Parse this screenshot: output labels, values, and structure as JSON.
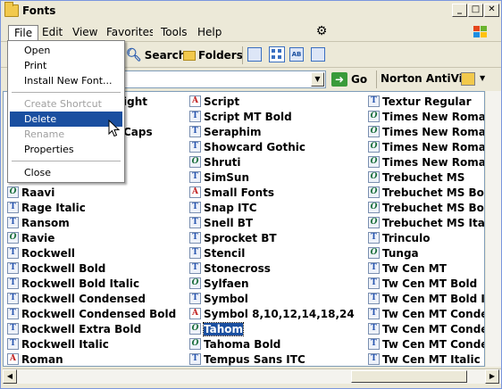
{
  "window": {
    "title": "Fonts"
  },
  "title_buttons": {
    "minimize": "_",
    "maximize": "□",
    "close": "✕"
  },
  "menubar": [
    "File",
    "Edit",
    "View",
    "Favorites",
    "Tools",
    "Help"
  ],
  "toolbar": {
    "search": "Search",
    "folders": "Folders"
  },
  "address": {
    "go": "Go",
    "norton": "Norton AntiVir"
  },
  "file_menu": {
    "items": [
      {
        "label": "Open",
        "state": "normal"
      },
      {
        "label": "Print",
        "state": "normal"
      },
      {
        "label": "Install New Font...",
        "state": "normal"
      },
      {
        "sep": true
      },
      {
        "label": "Create Shortcut",
        "state": "disabled"
      },
      {
        "label": "Delete",
        "state": "highlighted"
      },
      {
        "label": "Rename",
        "state": "disabled"
      },
      {
        "label": "Properties",
        "state": "normal"
      },
      {
        "sep": true
      },
      {
        "label": "Close",
        "state": "normal"
      }
    ]
  },
  "fonts": {
    "col1_partial": [
      "ight",
      "",
      "Caps"
    ],
    "col1": [
      {
        "name": "Raavi",
        "type": "o"
      },
      {
        "name": "Rage Italic",
        "type": "t"
      },
      {
        "name": "Ransom",
        "type": "t"
      },
      {
        "name": "Ravie",
        "type": "o"
      },
      {
        "name": "Rockwell",
        "type": "t"
      },
      {
        "name": "Rockwell Bold",
        "type": "t"
      },
      {
        "name": "Rockwell Bold Italic",
        "type": "t"
      },
      {
        "name": "Rockwell Condensed",
        "type": "t"
      },
      {
        "name": "Rockwell Condensed Bold",
        "type": "t"
      },
      {
        "name": "Rockwell Extra Bold",
        "type": "t"
      },
      {
        "name": "Rockwell Italic",
        "type": "t"
      },
      {
        "name": "Roman",
        "type": "a"
      }
    ],
    "col2": [
      {
        "name": "Script",
        "type": "a"
      },
      {
        "name": "Script MT Bold",
        "type": "t"
      },
      {
        "name": "Seraphim",
        "type": "t"
      },
      {
        "name": "Showcard Gothic",
        "type": "t"
      },
      {
        "name": "Shruti",
        "type": "o"
      },
      {
        "name": "SimSun",
        "type": "t"
      },
      {
        "name": "Small Fonts",
        "type": "a"
      },
      {
        "name": "Snap ITC",
        "type": "t"
      },
      {
        "name": "Snell BT",
        "type": "t"
      },
      {
        "name": "Sprocket BT",
        "type": "t"
      },
      {
        "name": "Stencil",
        "type": "t"
      },
      {
        "name": "Stonecross",
        "type": "t"
      },
      {
        "name": "Sylfaen",
        "type": "o"
      },
      {
        "name": "Symbol",
        "type": "t"
      },
      {
        "name": "Symbol 8,10,12,14,18,24",
        "type": "a"
      },
      {
        "name": "Tahom",
        "type": "o",
        "selected": true
      },
      {
        "name": "Tahoma Bold",
        "type": "o"
      },
      {
        "name": "Tempus Sans ITC",
        "type": "t"
      }
    ],
    "col3": [
      {
        "name": "Textur Regular",
        "type": "t"
      },
      {
        "name": "Times New Roman",
        "type": "o"
      },
      {
        "name": "Times New Roman Bold",
        "type": "o"
      },
      {
        "name": "Times New Roman Bold",
        "type": "o"
      },
      {
        "name": "Times New Roman Italic",
        "type": "o"
      },
      {
        "name": "Trebuchet MS",
        "type": "o"
      },
      {
        "name": "Trebuchet MS Bold",
        "type": "o"
      },
      {
        "name": "Trebuchet MS Bold Itali",
        "type": "o"
      },
      {
        "name": "Trebuchet MS Italic",
        "type": "o"
      },
      {
        "name": "Trinculo",
        "type": "t"
      },
      {
        "name": "Tunga",
        "type": "o"
      },
      {
        "name": "Tw Cen MT",
        "type": "t"
      },
      {
        "name": "Tw Cen MT Bold",
        "type": "t"
      },
      {
        "name": "Tw Cen MT Bold Italic",
        "type": "t"
      },
      {
        "name": "Tw Cen MT Condensed",
        "type": "t"
      },
      {
        "name": "Tw Cen MT Condensed I",
        "type": "t"
      },
      {
        "name": "Tw Cen MT Condensed I",
        "type": "t"
      },
      {
        "name": "Tw Cen MT Italic",
        "type": "t"
      }
    ]
  }
}
